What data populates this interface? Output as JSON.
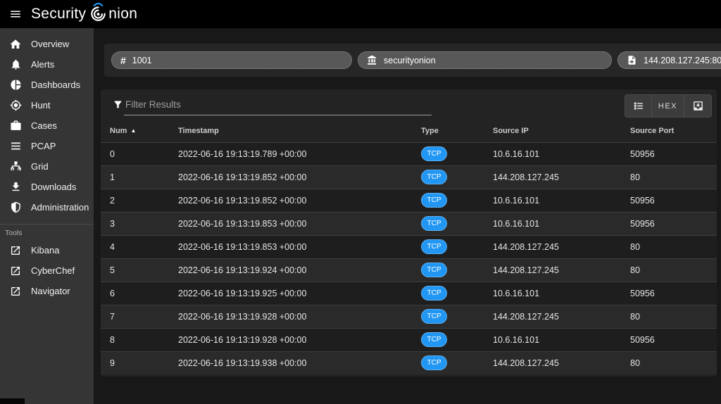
{
  "topbar": {
    "brand_prefix": "Security",
    "brand_suffix": "nion"
  },
  "sidebar": {
    "items": [
      {
        "label": "Overview",
        "icon": "home-icon"
      },
      {
        "label": "Alerts",
        "icon": "bell-icon"
      },
      {
        "label": "Dashboards",
        "icon": "pie-chart-icon"
      },
      {
        "label": "Hunt",
        "icon": "crosshairs-icon"
      },
      {
        "label": "Cases",
        "icon": "briefcase-icon"
      },
      {
        "label": "PCAP",
        "icon": "lines-icon"
      },
      {
        "label": "Grid",
        "icon": "sitemap-icon"
      },
      {
        "label": "Downloads",
        "icon": "download-icon"
      },
      {
        "label": "Administration",
        "icon": "shield-icon"
      }
    ],
    "tools_label": "Tools",
    "tools": [
      {
        "label": "Kibana",
        "icon": "external-link-icon"
      },
      {
        "label": "CyberChef",
        "icon": "external-link-icon"
      },
      {
        "label": "Navigator",
        "icon": "external-link-icon"
      }
    ]
  },
  "chips": [
    {
      "icon": "pound-icon",
      "label": "1001"
    },
    {
      "icon": "sensor-icon",
      "label": "securityonion"
    },
    {
      "icon": "file-export-icon",
      "label": "144.208.127.245:80"
    }
  ],
  "filter": {
    "placeholder": "Filter Results"
  },
  "view_toggle": {
    "hex_label": "HEX"
  },
  "table": {
    "columns": [
      "Num",
      "Timestamp",
      "Type",
      "Source IP",
      "Source Port"
    ],
    "sort_column": "Num",
    "sort_direction": "ascending",
    "rows": [
      {
        "num": "0",
        "timestamp": "2022-06-16 19:13:19.789 +00:00",
        "type": "TCP",
        "source_ip": "10.6.16.101",
        "source_port": "50956"
      },
      {
        "num": "1",
        "timestamp": "2022-06-16 19:13:19.852 +00:00",
        "type": "TCP",
        "source_ip": "144.208.127.245",
        "source_port": "80"
      },
      {
        "num": "2",
        "timestamp": "2022-06-16 19:13:19.852 +00:00",
        "type": "TCP",
        "source_ip": "10.6.16.101",
        "source_port": "50956"
      },
      {
        "num": "3",
        "timestamp": "2022-06-16 19:13:19.853 +00:00",
        "type": "TCP",
        "source_ip": "10.6.16.101",
        "source_port": "50956"
      },
      {
        "num": "4",
        "timestamp": "2022-06-16 19:13:19.853 +00:00",
        "type": "TCP",
        "source_ip": "144.208.127.245",
        "source_port": "80"
      },
      {
        "num": "5",
        "timestamp": "2022-06-16 19:13:19.924 +00:00",
        "type": "TCP",
        "source_ip": "144.208.127.245",
        "source_port": "80"
      },
      {
        "num": "6",
        "timestamp": "2022-06-16 19:13:19.925 +00:00",
        "type": "TCP",
        "source_ip": "10.6.16.101",
        "source_port": "50956"
      },
      {
        "num": "7",
        "timestamp": "2022-06-16 19:13:19.928 +00:00",
        "type": "TCP",
        "source_ip": "144.208.127.245",
        "source_port": "80"
      },
      {
        "num": "8",
        "timestamp": "2022-06-16 19:13:19.928 +00:00",
        "type": "TCP",
        "source_ip": "10.6.16.101",
        "source_port": "50956"
      },
      {
        "num": "9",
        "timestamp": "2022-06-16 19:13:19.938 +00:00",
        "type": "TCP",
        "source_ip": "144.208.127.245",
        "source_port": "80"
      }
    ]
  },
  "colors": {
    "accent_blue": "#2196f3",
    "logo_blue": "#2196f3",
    "topbar_bg": "#000000",
    "sidebar_bg": "#353535",
    "card_bg": "#232323"
  }
}
